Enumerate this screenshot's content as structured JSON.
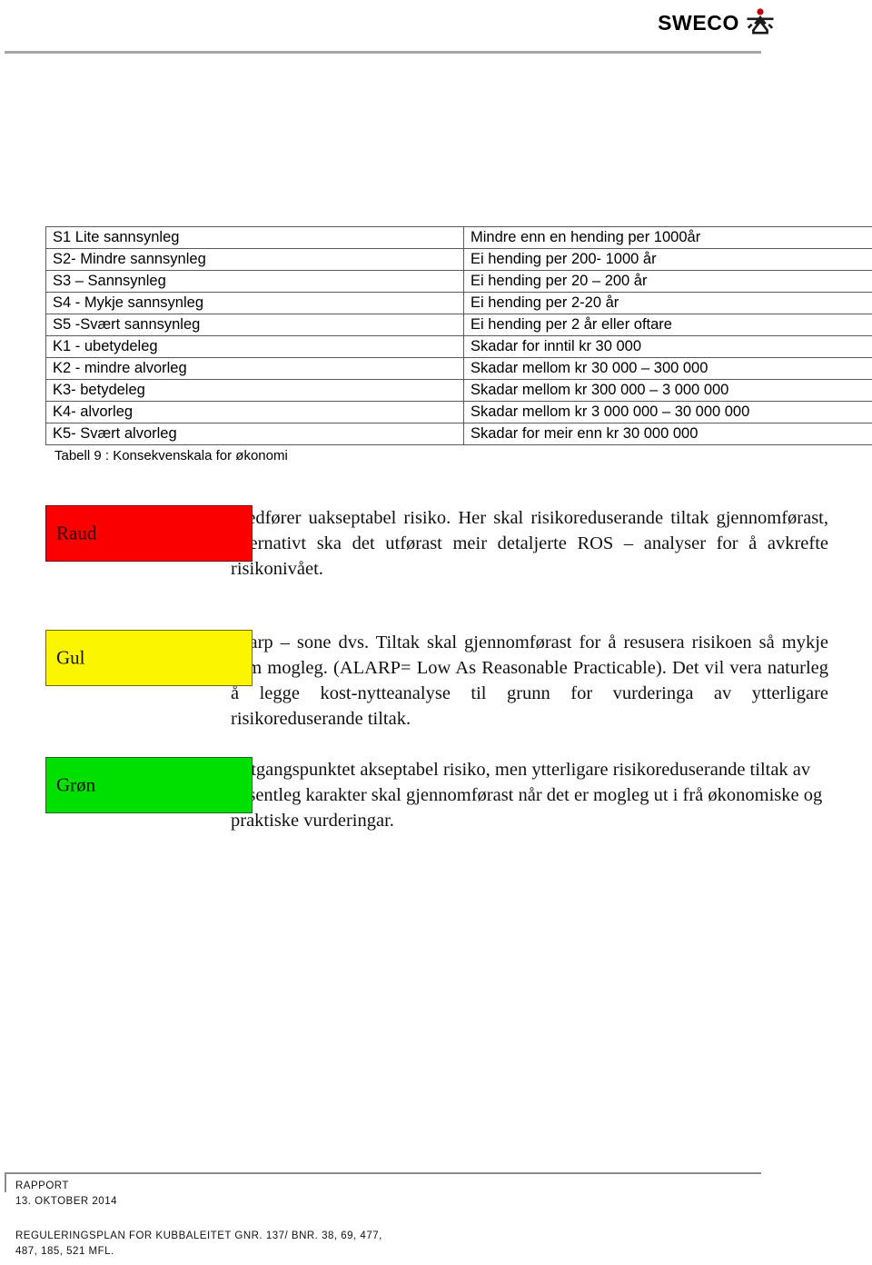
{
  "header": {
    "logo_text": "SWECO",
    "logo_mark_name": "sweco-figure-mark",
    "mark_dot_color": "#c00000",
    "mark_body_color": "#1a1a1a"
  },
  "scale_table": {
    "caption": "Tabell 9 : Konsekvenskala for økonomi",
    "rows": [
      {
        "code": "S1 Lite sannsynleg",
        "desc": "Mindre enn en hending per 1000år"
      },
      {
        "code": "S2- Mindre sannsynleg",
        "desc": "Ei hending per 200- 1000 år"
      },
      {
        "code": "S3 – Sannsynleg",
        "desc": "Ei hending per 20 – 200 år"
      },
      {
        "code": "S4 - Mykje sannsynleg",
        "desc": "Ei hending per 2-20 år"
      },
      {
        "code": "S5 -Svært sannsynleg",
        "desc": "Ei hending per 2 år eller oftare"
      },
      {
        "code": "K1 - ubetydeleg",
        "desc": "Skadar for inntil kr 30 000"
      },
      {
        "code": "K2 - mindre alvorleg",
        "desc": "Skadar mellom kr 30 000 – 300 000"
      },
      {
        "code": "K3- betydeleg",
        "desc": "Skadar mellom kr 300 000 – 3 000 000"
      },
      {
        "code": "K4- alvorleg",
        "desc": "Skadar mellom kr 3 000 000 – 30 000 000"
      },
      {
        "code": "K5- Svært alvorleg",
        "desc": "Skadar for meir enn kr 30 000 000"
      }
    ]
  },
  "risk_levels": [
    {
      "label": "Raud",
      "color": "#fa0000",
      "text": "Medfører uakseptabel risiko. Her skal risikoreduserande tiltak gjennomførast, alternativt ska det utførast meir detaljerte ROS – analyser for å avkrefte risikonivået."
    },
    {
      "label": "Gul",
      "color": "#fcf500",
      "text": "Alarp – sone dvs. Tiltak skal gjennomførast  for å resusera risikoen så mykje som      mogleg. (ALARP= Low As Reasonable Practicable). Det vil vera naturleg å legge kost-nytteanalyse til grunn for vurderinga av ytterligare risikoreduserande tiltak."
    },
    {
      "label": "Grøn",
      "color": "#00e000",
      "text": "I utgangspunktet akseptabel risiko, men ytterligare risikoreduserande tiltak av vesentleg  karakter skal gjennomførast når det er mogleg ut i frå økonomiske og praktiske vurderingar."
    }
  ],
  "footer": {
    "doc_type": "RAPPORT",
    "date": "13. OKTOBER 2014",
    "project_line_1": "REGULERINGSPLAN FOR KUBBALEITET GNR. 137/ BNR. 38, 69, 477,",
    "project_line_2": "487, 185, 521 MFL."
  }
}
